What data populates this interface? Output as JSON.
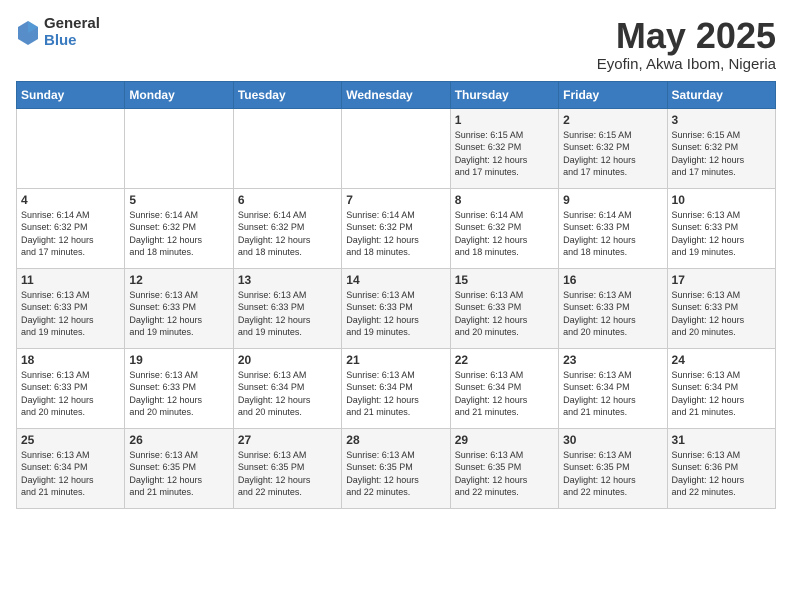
{
  "header": {
    "logo_general": "General",
    "logo_blue": "Blue",
    "month": "May 2025",
    "location": "Eyofin, Akwa Ibom, Nigeria"
  },
  "days_of_week": [
    "Sunday",
    "Monday",
    "Tuesday",
    "Wednesday",
    "Thursday",
    "Friday",
    "Saturday"
  ],
  "weeks": [
    [
      {
        "day": "",
        "info": ""
      },
      {
        "day": "",
        "info": ""
      },
      {
        "day": "",
        "info": ""
      },
      {
        "day": "",
        "info": ""
      },
      {
        "day": "1",
        "info": "Sunrise: 6:15 AM\nSunset: 6:32 PM\nDaylight: 12 hours\nand 17 minutes."
      },
      {
        "day": "2",
        "info": "Sunrise: 6:15 AM\nSunset: 6:32 PM\nDaylight: 12 hours\nand 17 minutes."
      },
      {
        "day": "3",
        "info": "Sunrise: 6:15 AM\nSunset: 6:32 PM\nDaylight: 12 hours\nand 17 minutes."
      }
    ],
    [
      {
        "day": "4",
        "info": "Sunrise: 6:14 AM\nSunset: 6:32 PM\nDaylight: 12 hours\nand 17 minutes."
      },
      {
        "day": "5",
        "info": "Sunrise: 6:14 AM\nSunset: 6:32 PM\nDaylight: 12 hours\nand 18 minutes."
      },
      {
        "day": "6",
        "info": "Sunrise: 6:14 AM\nSunset: 6:32 PM\nDaylight: 12 hours\nand 18 minutes."
      },
      {
        "day": "7",
        "info": "Sunrise: 6:14 AM\nSunset: 6:32 PM\nDaylight: 12 hours\nand 18 minutes."
      },
      {
        "day": "8",
        "info": "Sunrise: 6:14 AM\nSunset: 6:32 PM\nDaylight: 12 hours\nand 18 minutes."
      },
      {
        "day": "9",
        "info": "Sunrise: 6:14 AM\nSunset: 6:33 PM\nDaylight: 12 hours\nand 18 minutes."
      },
      {
        "day": "10",
        "info": "Sunrise: 6:13 AM\nSunset: 6:33 PM\nDaylight: 12 hours\nand 19 minutes."
      }
    ],
    [
      {
        "day": "11",
        "info": "Sunrise: 6:13 AM\nSunset: 6:33 PM\nDaylight: 12 hours\nand 19 minutes."
      },
      {
        "day": "12",
        "info": "Sunrise: 6:13 AM\nSunset: 6:33 PM\nDaylight: 12 hours\nand 19 minutes."
      },
      {
        "day": "13",
        "info": "Sunrise: 6:13 AM\nSunset: 6:33 PM\nDaylight: 12 hours\nand 19 minutes."
      },
      {
        "day": "14",
        "info": "Sunrise: 6:13 AM\nSunset: 6:33 PM\nDaylight: 12 hours\nand 19 minutes."
      },
      {
        "day": "15",
        "info": "Sunrise: 6:13 AM\nSunset: 6:33 PM\nDaylight: 12 hours\nand 20 minutes."
      },
      {
        "day": "16",
        "info": "Sunrise: 6:13 AM\nSunset: 6:33 PM\nDaylight: 12 hours\nand 20 minutes."
      },
      {
        "day": "17",
        "info": "Sunrise: 6:13 AM\nSunset: 6:33 PM\nDaylight: 12 hours\nand 20 minutes."
      }
    ],
    [
      {
        "day": "18",
        "info": "Sunrise: 6:13 AM\nSunset: 6:33 PM\nDaylight: 12 hours\nand 20 minutes."
      },
      {
        "day": "19",
        "info": "Sunrise: 6:13 AM\nSunset: 6:33 PM\nDaylight: 12 hours\nand 20 minutes."
      },
      {
        "day": "20",
        "info": "Sunrise: 6:13 AM\nSunset: 6:34 PM\nDaylight: 12 hours\nand 20 minutes."
      },
      {
        "day": "21",
        "info": "Sunrise: 6:13 AM\nSunset: 6:34 PM\nDaylight: 12 hours\nand 21 minutes."
      },
      {
        "day": "22",
        "info": "Sunrise: 6:13 AM\nSunset: 6:34 PM\nDaylight: 12 hours\nand 21 minutes."
      },
      {
        "day": "23",
        "info": "Sunrise: 6:13 AM\nSunset: 6:34 PM\nDaylight: 12 hours\nand 21 minutes."
      },
      {
        "day": "24",
        "info": "Sunrise: 6:13 AM\nSunset: 6:34 PM\nDaylight: 12 hours\nand 21 minutes."
      }
    ],
    [
      {
        "day": "25",
        "info": "Sunrise: 6:13 AM\nSunset: 6:34 PM\nDaylight: 12 hours\nand 21 minutes."
      },
      {
        "day": "26",
        "info": "Sunrise: 6:13 AM\nSunset: 6:35 PM\nDaylight: 12 hours\nand 21 minutes."
      },
      {
        "day": "27",
        "info": "Sunrise: 6:13 AM\nSunset: 6:35 PM\nDaylight: 12 hours\nand 22 minutes."
      },
      {
        "day": "28",
        "info": "Sunrise: 6:13 AM\nSunset: 6:35 PM\nDaylight: 12 hours\nand 22 minutes."
      },
      {
        "day": "29",
        "info": "Sunrise: 6:13 AM\nSunset: 6:35 PM\nDaylight: 12 hours\nand 22 minutes."
      },
      {
        "day": "30",
        "info": "Sunrise: 6:13 AM\nSunset: 6:35 PM\nDaylight: 12 hours\nand 22 minutes."
      },
      {
        "day": "31",
        "info": "Sunrise: 6:13 AM\nSunset: 6:36 PM\nDaylight: 12 hours\nand 22 minutes."
      }
    ]
  ]
}
